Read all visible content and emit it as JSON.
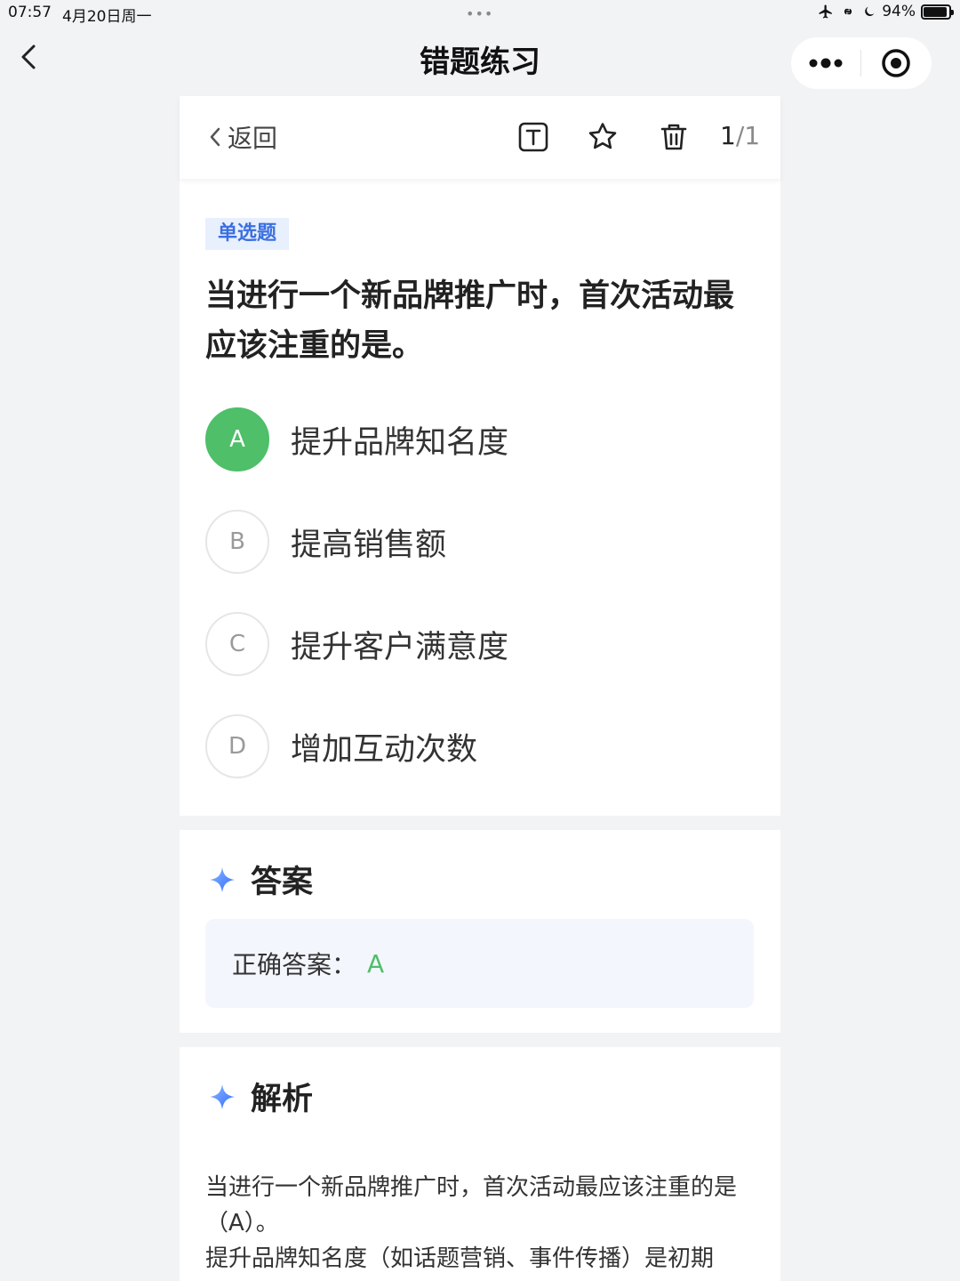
{
  "status_bar": {
    "time": "07:57",
    "date": "4月20日周一",
    "battery": "94%",
    "battery_level": 0.94
  },
  "nav": {
    "title": "错题练习"
  },
  "toolbar": {
    "back_label": "返回",
    "current": "1",
    "total": "/1"
  },
  "question": {
    "type_tag": "单选题",
    "text": "当进行一个新品牌推广时，首次活动最应该注重的是。",
    "options": [
      {
        "letter": "A",
        "text": "提升品牌知名度",
        "state": "correct"
      },
      {
        "letter": "B",
        "text": "提高销售额",
        "state": "normal"
      },
      {
        "letter": "C",
        "text": "提升客户满意度",
        "state": "normal"
      },
      {
        "letter": "D",
        "text": "增加互动次数",
        "state": "normal"
      }
    ]
  },
  "answer": {
    "title": "答案",
    "label": "正确答案：",
    "value": "A"
  },
  "analysis": {
    "title": "解析",
    "line1": "当进行一个新品牌推广时，首次活动最应该注重的是（A）。",
    "line2": "提升品牌知名度（如话题营销、事件传播）是初期"
  },
  "colors": {
    "correct": "#4fbf69",
    "accent_blue": "#3a6fe0",
    "tag_bg": "#e8f0fe",
    "answer_bg": "#f3f6fd"
  }
}
